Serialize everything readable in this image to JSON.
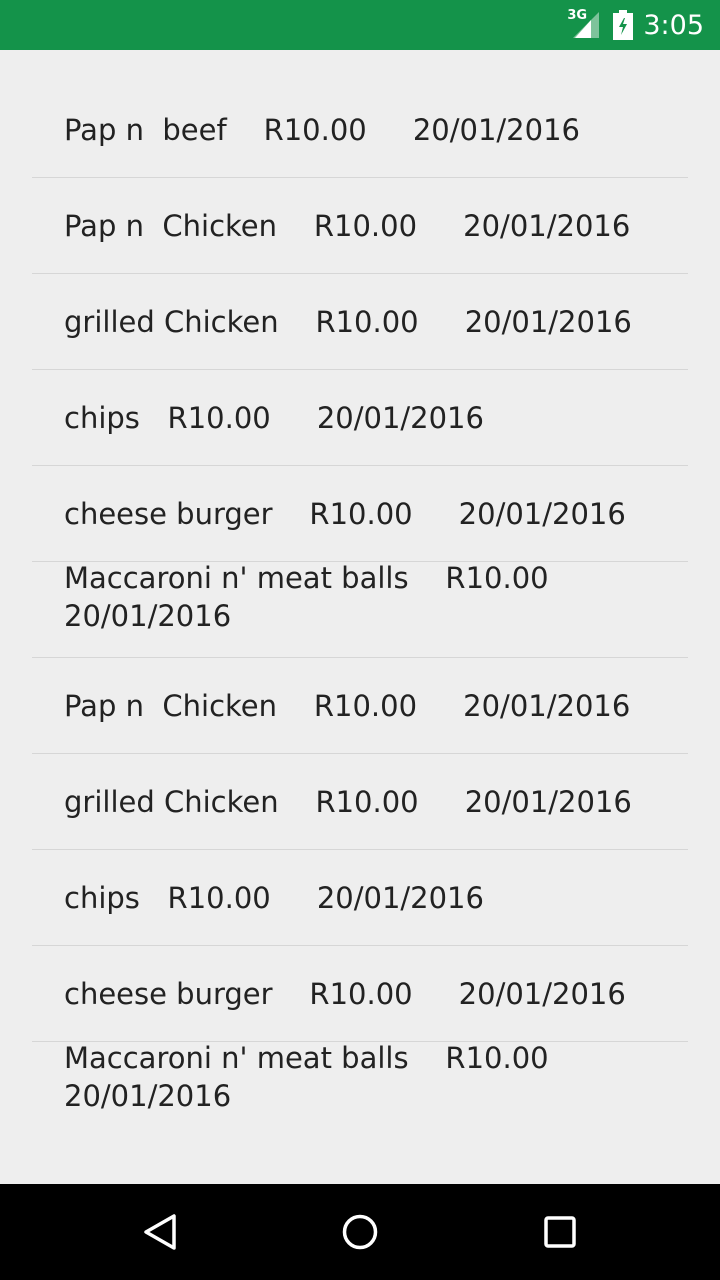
{
  "status_bar": {
    "network": "3G",
    "time": "3:05",
    "icons": [
      "signal-icon",
      "battery-icon"
    ]
  },
  "orders": [
    {
      "line1": "Pap n  beef    R10.00     20/01/2016"
    },
    {
      "line1": "Pap n  Chicken    R10.00     20/01/2016"
    },
    {
      "line1": "grilled Chicken    R10.00     20/01/2016"
    },
    {
      "line1": "chips   R10.00     20/01/2016"
    },
    {
      "line1": "cheese burger    R10.00     20/01/2016"
    },
    {
      "line1": "Maccaroni n' meat balls    R10.00\n20/01/2016"
    },
    {
      "line1": "Pap n  Chicken    R10.00     20/01/2016"
    },
    {
      "line1": "grilled Chicken    R10.00     20/01/2016"
    },
    {
      "line1": "chips   R10.00     20/01/2016"
    },
    {
      "line1": "cheese burger    R10.00     20/01/2016"
    },
    {
      "line1": "Maccaroni n' meat balls    R10.00\n20/01/2016"
    }
  ],
  "nav_bar": {
    "icons": [
      "back-icon",
      "home-icon",
      "recents-icon"
    ]
  },
  "colors": {
    "status_bar": "#14934a",
    "background": "#eeeeee",
    "divider": "#d6d6d6",
    "nav_bar": "#000000"
  }
}
